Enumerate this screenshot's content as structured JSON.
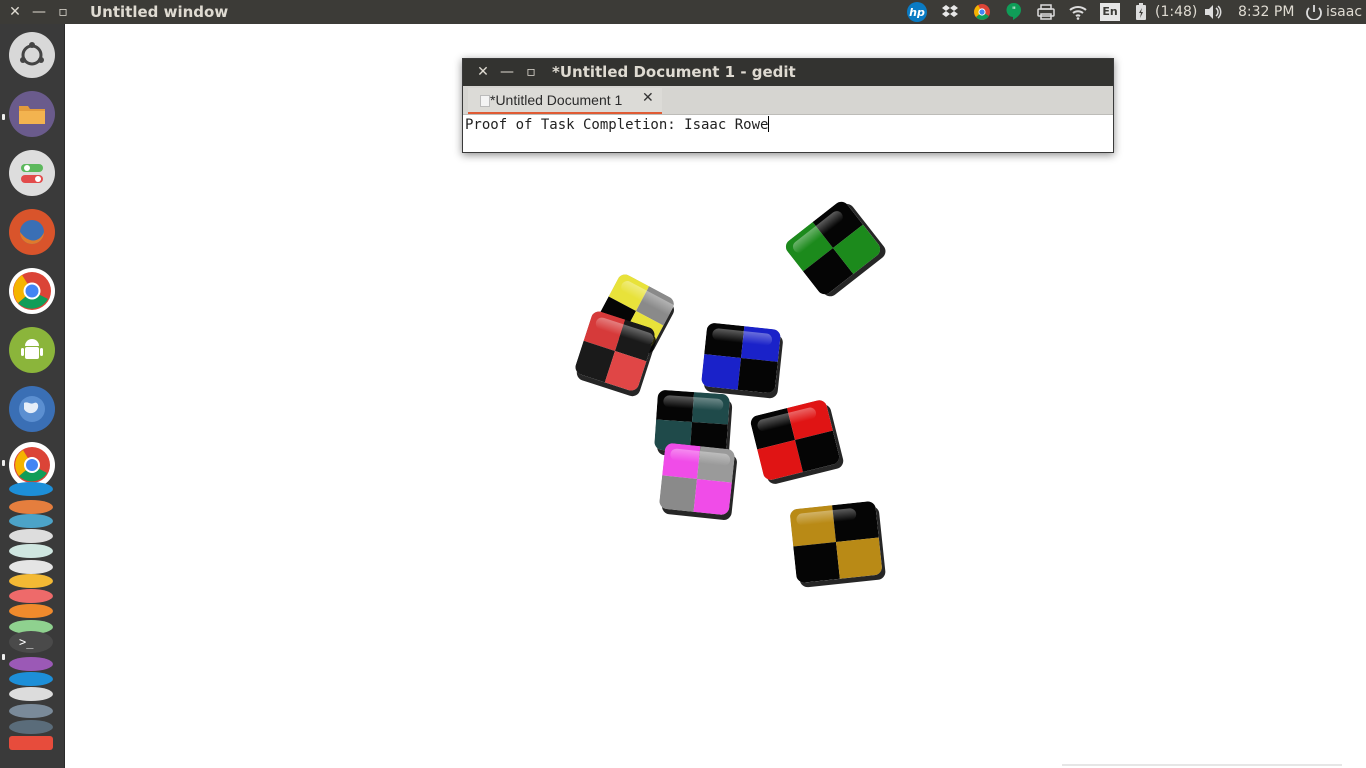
{
  "panel": {
    "title": "Untitled window",
    "close_glyph": "✕",
    "minimize_glyph": "—",
    "maximize_glyph": "▫",
    "battery_text": "(1:48)",
    "clock": "8:32 PM",
    "keyboard_layout": "En",
    "username": "isaac",
    "icons": [
      "hp-icon",
      "dropbox-icon",
      "chrome-icon",
      "hangouts-icon",
      "printer-icon",
      "wifi-icon",
      "keyboard-icon",
      "battery-icon",
      "volume-icon",
      "session-icon"
    ]
  },
  "launcher": {
    "items": [
      "ubuntu-dash",
      "files",
      "system-settings",
      "firefox",
      "chrome",
      "android-studio",
      "web-browser",
      "chrome-2",
      "app-1",
      "app-2",
      "app-3",
      "app-4",
      "app-5",
      "app-6",
      "terminal",
      "app-7",
      "app-8",
      "app-9",
      "app-10",
      "app-11"
    ],
    "colors": [
      "#e0e0e0",
      "#6a5b8c",
      "#dddddd",
      "#d9542b",
      "#ffffff",
      "#8bb53b",
      "#3a6fb5"
    ]
  },
  "gedit": {
    "window_title": "*Untitled Document 1 - gedit",
    "tab_label": "*Untitled Document 1",
    "tab_close_glyph": "✕",
    "content": "Proof of Task Completion: Isaac Rowe",
    "close_glyph": "✕",
    "minimize_glyph": "—",
    "maximize_glyph": "▫"
  },
  "scene": {
    "cubes": [
      {
        "name": "green-cube",
        "color": "#1c8a1c"
      },
      {
        "name": "yellow-cube",
        "color": "#e8e23a"
      },
      {
        "name": "red-gray-cube",
        "color": "#d63a3a"
      },
      {
        "name": "blue-cube",
        "color": "#1a22c9"
      },
      {
        "name": "teal-cube",
        "color": "#1f4a4a"
      },
      {
        "name": "red-cube",
        "color": "#e01414"
      },
      {
        "name": "pink-cube",
        "color": "#f04ce8"
      },
      {
        "name": "gold-cube",
        "color": "#b98a16"
      }
    ]
  }
}
